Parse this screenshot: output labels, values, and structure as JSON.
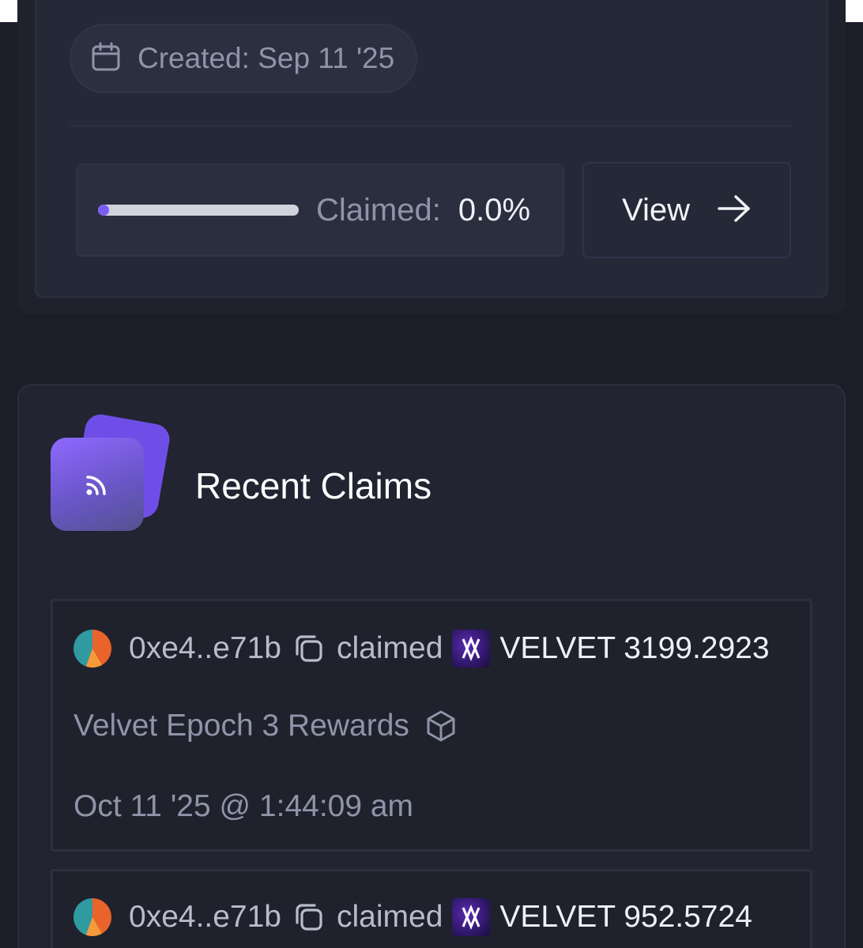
{
  "campaign_card": {
    "created_label": "Created: Sep 11 '25",
    "claimed_label": "Claimed:",
    "claimed_value": "0.0%",
    "claimed_fraction": 0.0,
    "view_button": "View"
  },
  "recent_claims": {
    "title": "Recent Claims",
    "items": [
      {
        "address": "0xe4..e71b",
        "action": "claimed",
        "token_amount": "VELVET 3199.2923",
        "campaign": "Velvet Epoch 3 Rewards",
        "timestamp": "Oct 11 '25 @ 1:44:09 am"
      },
      {
        "address": "0xe4..e71b",
        "action": "claimed",
        "token_amount": "VELVET 952.5724"
      }
    ]
  },
  "colors": {
    "accent": "#7b5cf5",
    "background": "#1b1d27",
    "muted_text": "#8f94a8"
  },
  "icons": [
    "calendar-icon",
    "arrow-right-icon",
    "rss-feed-icon",
    "copy-icon",
    "velvet-token-logo",
    "cube-icon"
  ]
}
